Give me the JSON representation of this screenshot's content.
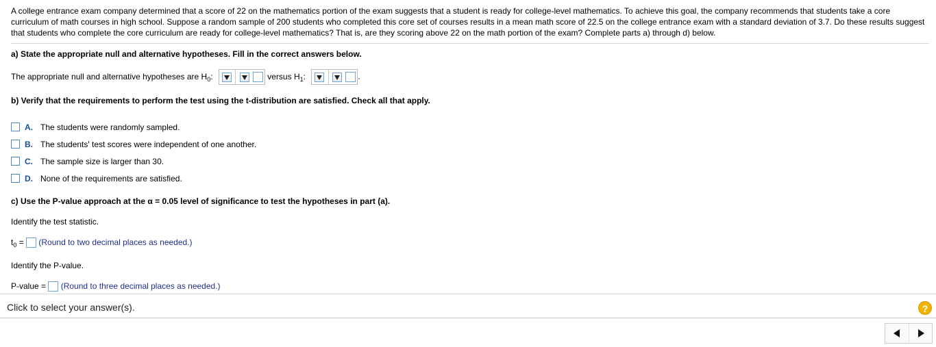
{
  "problem": {
    "text": "A college entrance exam company determined that a score of 22 on the mathematics portion of the exam suggests that a student is ready for college-level mathematics. To achieve this goal, the company recommends that students take a core curriculum of math courses in high school. Suppose a random sample of 200 students who completed this core set of courses results in a mean math score of 22.5 on the college entrance exam with a standard deviation of 3.7. Do these results suggest that students who complete the core curriculum are ready for college-level mathematics? That is, are they scoring above 22 on the math portion of the exam? Complete parts a) through d) below."
  },
  "part_a": {
    "heading": "a) State the appropriate null and alternative hypotheses. Fill in the correct answers below.",
    "sentence_prefix": "The appropriate null and alternative hypotheses are H",
    "h0_sub": "0",
    "colon": ":",
    "versus": "versus H",
    "h1_sub": "1",
    "period": "."
  },
  "part_b": {
    "heading": "b) Verify that the requirements to perform the test using the t-distribution are satisfied. Check all that apply.",
    "choices": [
      {
        "letter": "A.",
        "text": "The students were randomly sampled."
      },
      {
        "letter": "B.",
        "text": "The students' test scores were independent of one another."
      },
      {
        "letter": "C.",
        "text": "The sample size is larger than 30."
      },
      {
        "letter": "D.",
        "text": "None of the requirements are satisfied."
      }
    ]
  },
  "part_c": {
    "heading": "c) Use the P-value approach at the α = 0.05 level of significance to test the hypotheses in part (a).",
    "identify_stat": "Identify the test statistic.",
    "t0_label": "t",
    "t0_sub": "0",
    "t0_eq": " =",
    "t0_hint": "(Round to two decimal places as needed.)",
    "identify_p": "Identify the P-value.",
    "p_label": "P-value =",
    "p_hint": "(Round to three decimal places as needed.)"
  },
  "footer": {
    "status": "Click to select your answer(s).",
    "help": "?"
  },
  "colors": {
    "accent": "#1a4f9c",
    "hint": "#1f2f8c",
    "help": "#f0b400"
  }
}
